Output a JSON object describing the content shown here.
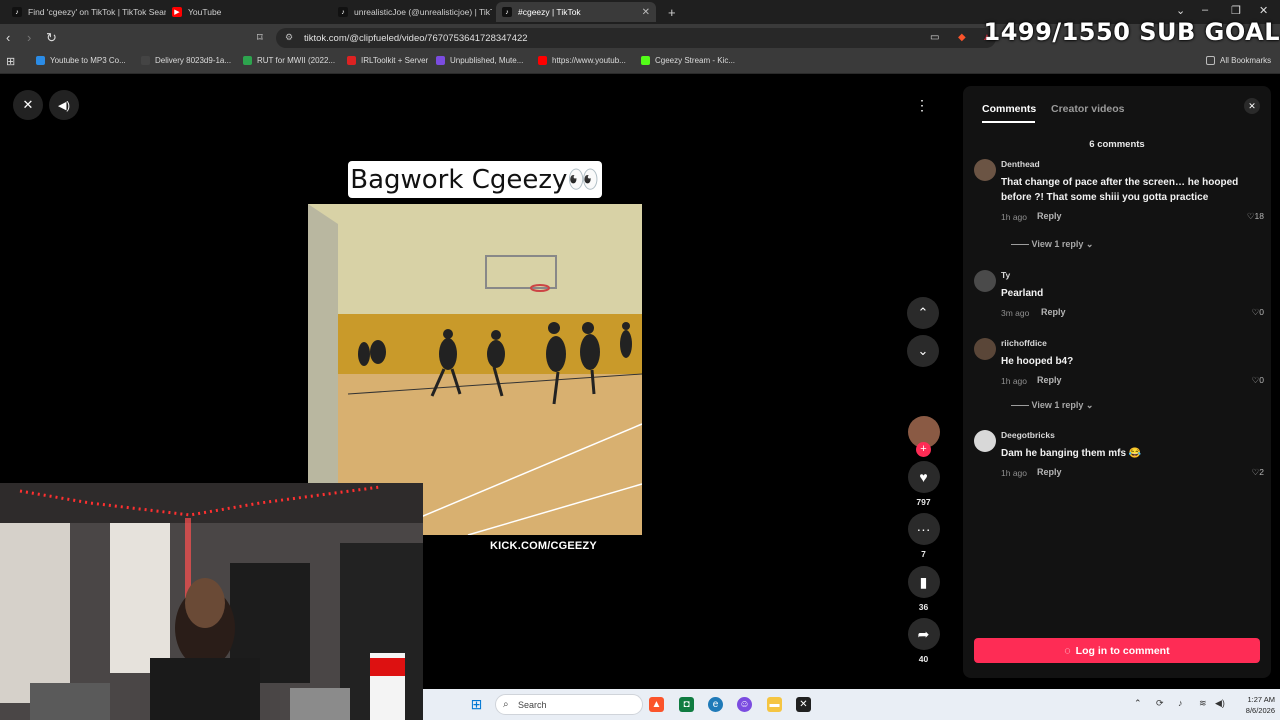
{
  "browser": {
    "tabs": [
      {
        "label": "Find 'cgeezy' on TikTok | TikTok Searc",
        "active": false
      },
      {
        "label": "YouTube",
        "active": false
      },
      {
        "label": "unrealisticJoe (@unrealisticjoe) | TikT",
        "active": false
      },
      {
        "label": "#cgeezy | TikTok",
        "active": true
      }
    ],
    "new_tab": "+",
    "url": "tiktok.com/@clipfueled/video/7670753641728347422",
    "bookmarks": [
      {
        "label": "Youtube to MP3 Co..."
      },
      {
        "label": "Delivery 8023d9-1a..."
      },
      {
        "label": "RUT for MWII (2022..."
      },
      {
        "label": "IRLToolkit + Server"
      },
      {
        "label": "Unpublished, Mute..."
      },
      {
        "label": "https://www.youtub..."
      },
      {
        "label": "Cgeezy Stream - Kic..."
      }
    ],
    "all_bookmarks": "All Bookmarks"
  },
  "overlay": {
    "sub_goal": "1499/1550 SUB GOAL"
  },
  "video": {
    "caption": "Bagwork Cgeezy👀",
    "watermark": "KICK.COM/CGEEZY"
  },
  "actions": {
    "likes": "797",
    "comments": "7",
    "saves": "36",
    "shares": "40"
  },
  "panel": {
    "tab_comments": "Comments",
    "tab_creator_videos": "Creator videos",
    "comment_count": "6 comments",
    "comments": [
      {
        "user": "Denthead",
        "text": "That change of pace after the screen… he hooped before ?! That some shiii you gotta practice",
        "time": "1h ago",
        "reply": "Reply",
        "likes": "18",
        "view_replies": "View 1 reply"
      },
      {
        "user": "Ty",
        "text": "Pearland",
        "time": "3m ago",
        "reply": "Reply",
        "likes": "0"
      },
      {
        "user": "riichoffdice",
        "text": "He hooped b4?",
        "time": "1h ago",
        "reply": "Reply",
        "likes": "0",
        "view_replies": "View 1 reply"
      },
      {
        "user": "Deegotbricks",
        "text": "Dam he banging them mfs 😂",
        "time": "1h ago",
        "reply": "Reply",
        "likes": "2"
      }
    ],
    "login_button": "Log in to comment"
  },
  "taskbar": {
    "search": "Search",
    "time": "1:27 AM",
    "date": "8/6/2026"
  },
  "colors": {
    "accent": "#fe2c55",
    "panel_bg": "#121212"
  }
}
